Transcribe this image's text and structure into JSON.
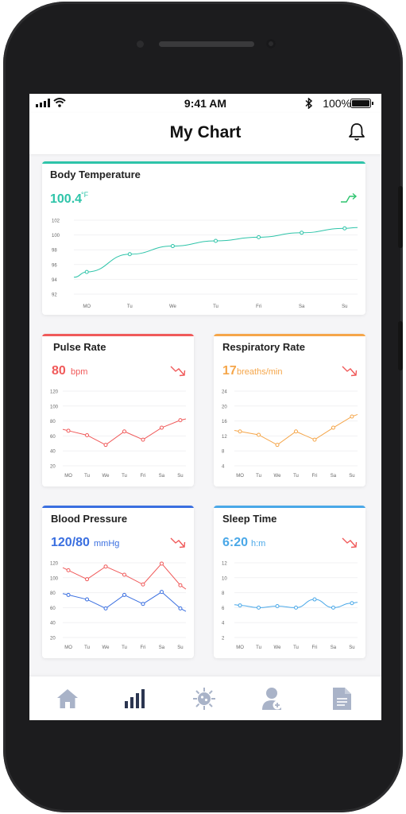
{
  "status": {
    "time": "9:41 AM",
    "battery": "100%"
  },
  "header": {
    "title": "My Chart"
  },
  "icons": {
    "signal": "signal-icon",
    "wifi": "wifi-icon",
    "bluetooth": "bluetooth-icon",
    "battery": "battery-icon",
    "bell": "bell-icon",
    "nav": [
      "home-icon",
      "chart-icon",
      "virus-icon",
      "doctor-icon",
      "document-icon"
    ]
  },
  "colors": {
    "temperature": "#2ec4a9",
    "pulse": "#f05a5a",
    "respiratory": "#f5a64a",
    "bp_systolic": "#f05a5a",
    "bp_diastolic": "#3a6fe0",
    "sleep": "#4aa8e8",
    "trend_up": "#2ec46f",
    "trend_down": "#f05a5a",
    "nav_inactive": "#a9b3c8",
    "nav_active": "#2b3550"
  },
  "cards": {
    "temperature": {
      "title": "Body Temperature",
      "value": "100.4",
      "unit": "°F",
      "trend": "up"
    },
    "pulse": {
      "title": "Pulse Rate",
      "value": "80",
      "unit": "bpm",
      "trend": "down"
    },
    "respiratory": {
      "title": "Respiratory Rate",
      "value": "17",
      "unit": "breaths/min",
      "trend": "down"
    },
    "bp": {
      "title": "Blood Pressure",
      "value": "120/80",
      "unit": "mmHg",
      "trend": "down"
    },
    "sleep": {
      "title": "Sleep Time",
      "value": "6:20",
      "unit": "h:m",
      "trend": "down"
    }
  },
  "chart_data": [
    {
      "id": "temperature",
      "type": "line",
      "title": "Body Temperature",
      "categories": [
        "MO",
        "Tu",
        "We",
        "Tu",
        "Fri",
        "Sa",
        "Su"
      ],
      "series": [
        {
          "values": [
            95.0,
            97.4,
            98.5,
            99.2,
            99.7,
            100.3,
            100.9
          ]
        }
      ],
      "ylim": [
        92,
        102
      ],
      "yticks": [
        92,
        94,
        96,
        98,
        100,
        102
      ],
      "grid": true
    },
    {
      "id": "pulse",
      "type": "line",
      "title": "Pulse Rate",
      "categories": [
        "MO",
        "Tu",
        "We",
        "Tu",
        "Fri",
        "Sa",
        "Su"
      ],
      "series": [
        {
          "values": [
            67,
            61,
            48,
            66,
            55,
            71,
            81
          ]
        }
      ],
      "ylim": [
        20,
        120
      ],
      "yticks": [
        20,
        40,
        60,
        80,
        100,
        120
      ],
      "grid": true
    },
    {
      "id": "respiratory",
      "type": "line",
      "title": "Respiratory Rate",
      "categories": [
        "MO",
        "Tu",
        "We",
        "Tu",
        "Fri",
        "Sa",
        "Su"
      ],
      "series": [
        {
          "values": [
            13.2,
            12.3,
            9.6,
            13.2,
            11.0,
            14.2,
            17.2
          ]
        }
      ],
      "ylim": [
        4,
        24
      ],
      "yticks": [
        4,
        8,
        12,
        16,
        20,
        24
      ],
      "grid": true
    },
    {
      "id": "bp",
      "type": "line",
      "title": "Blood Pressure",
      "categories": [
        "MO",
        "Tu",
        "We",
        "Tu",
        "Fri",
        "Sa",
        "Su"
      ],
      "series": [
        {
          "values": [
            110,
            98,
            115,
            104,
            91,
            119,
            90
          ]
        },
        {
          "values": [
            77,
            71,
            59,
            77,
            65,
            81,
            59
          ]
        }
      ],
      "ylim": [
        20,
        120
      ],
      "yticks": [
        20,
        40,
        60,
        80,
        100,
        120
      ],
      "grid": true
    },
    {
      "id": "sleep",
      "type": "line",
      "title": "Sleep Time",
      "categories": [
        "MO",
        "Tu",
        "We",
        "Tu",
        "Fri",
        "Sa",
        "Su"
      ],
      "series": [
        {
          "values": [
            6.3,
            6.0,
            6.2,
            6.0,
            7.1,
            6.0,
            6.6
          ]
        }
      ],
      "ylim": [
        2,
        12
      ],
      "yticks": [
        2,
        4,
        6,
        8,
        10,
        12
      ],
      "grid": true
    }
  ]
}
